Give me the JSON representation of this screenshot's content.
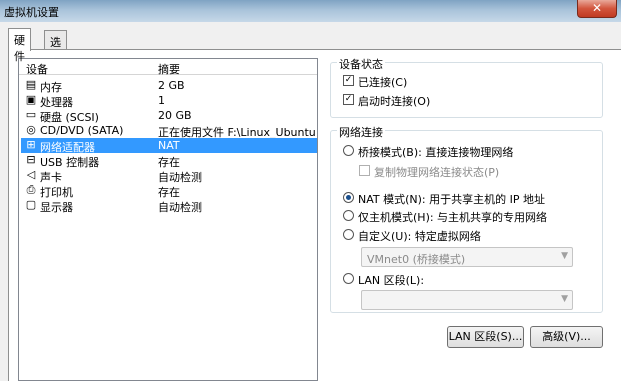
{
  "window": {
    "title": "虚拟机设置",
    "close_label": "✕"
  },
  "tabs": [
    {
      "label": "硬件"
    },
    {
      "label": "选项"
    }
  ],
  "device_list": {
    "headers": {
      "device": "设备",
      "summary": "摘要"
    },
    "rows": [
      {
        "icon": "memory-icon",
        "device": "内存",
        "summary": "2 GB"
      },
      {
        "icon": "processor-icon",
        "device": "处理器",
        "summary": "1"
      },
      {
        "icon": "hard-disk-icon",
        "device": "硬盘 (SCSI)",
        "summary": "20 GB"
      },
      {
        "icon": "cd-dvd-icon",
        "device": "CD/DVD (SATA)",
        "summary": "正在使用文件 F:\\Linux_Ubuntu..."
      },
      {
        "icon": "network-adapter-icon",
        "device": "网络适配器",
        "summary": "NAT"
      },
      {
        "icon": "usb-icon",
        "device": "USB 控制器",
        "summary": "存在"
      },
      {
        "icon": "sound-icon",
        "device": "声卡",
        "summary": "自动检测"
      },
      {
        "icon": "printer-icon",
        "device": "打印机",
        "summary": "存在"
      },
      {
        "icon": "display-icon",
        "device": "显示器",
        "summary": "自动检测"
      }
    ],
    "selected_index": 4
  },
  "device_status": {
    "title": "设备状态",
    "connected_label": "已连接(C)",
    "connected_checked": true,
    "connect_at_power_on_label": "启动时连接(O)",
    "connect_at_power_on_checked": true
  },
  "network_connection": {
    "title": "网络连接",
    "bridged_label": "桥接模式(B): 直接连接物理网络",
    "replicate_label": "复制物理网络连接状态(P)",
    "nat_label": "NAT 模式(N): 用于共享主机的 IP 地址",
    "host_only_label": "仅主机模式(H): 与主机共享的专用网络",
    "custom_label": "自定义(U): 特定虚拟网络",
    "custom_value": "VMnet0 (桥接模式)",
    "lan_segment_label": "LAN 区段(L):",
    "lan_segment_value": "",
    "selected": "nat"
  },
  "buttons": {
    "lan_segments": "LAN 区段(S)...",
    "advanced": "高级(V)..."
  }
}
